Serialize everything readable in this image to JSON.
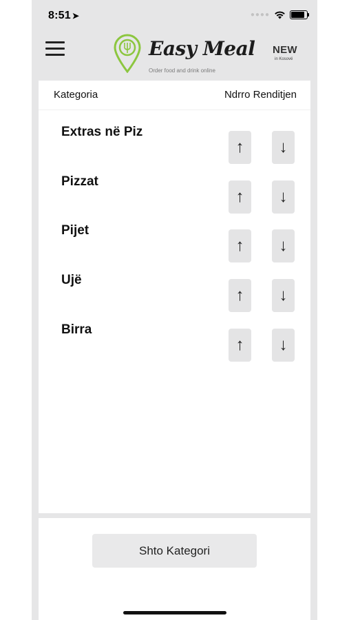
{
  "status_bar": {
    "time": "8:51",
    "location_icon": "location-arrow-icon",
    "signal_icon": "cellular-dots-icon",
    "wifi_icon": "wifi-icon",
    "battery_icon": "battery-icon"
  },
  "header": {
    "menu_icon": "hamburger-menu-icon",
    "logo_title": "Easy Meal",
    "logo_tagline": "Order food and drink online",
    "logo_accent": "#8cc63f",
    "badge_title": "NEW",
    "badge_sub": "in Kosovë"
  },
  "table": {
    "col_category": "Kategoria",
    "col_reorder": "Ndrro Renditjen",
    "rows": [
      {
        "name": "Extras në Piz"
      },
      {
        "name": "Pizzat"
      },
      {
        "name": "Pijet"
      },
      {
        "name": "Ujë"
      },
      {
        "name": "Birra"
      }
    ],
    "up_symbol": "↑",
    "down_symbol": "↓"
  },
  "footer": {
    "add_button": "Shto Kategori"
  }
}
